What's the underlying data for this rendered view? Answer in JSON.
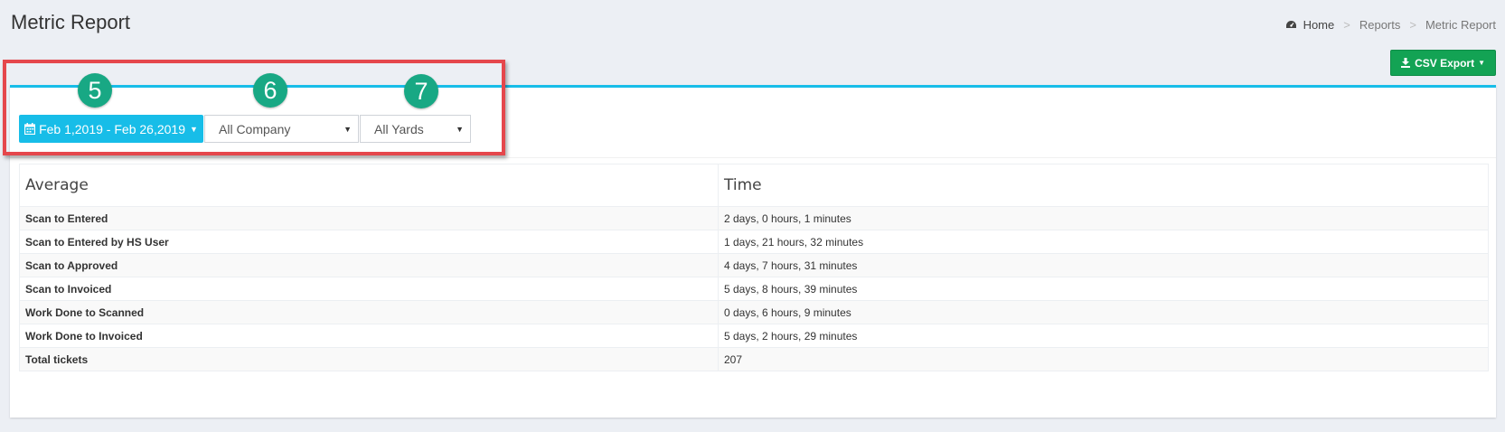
{
  "header": {
    "title": "Metric Report",
    "breadcrumb": {
      "home": "Home",
      "separator": ">",
      "items": [
        "Reports",
        "Metric Report"
      ]
    }
  },
  "toolbar": {
    "csv_export_label": "CSV Export",
    "csv_export_color": "#13a354"
  },
  "filters": {
    "date_range": "Feb 1,2019 - Feb 26,2019",
    "company": "All Company",
    "yards": "All Yards",
    "accent": "#17bde8"
  },
  "annotations": {
    "markers": [
      "5",
      "6",
      "7"
    ],
    "box_color": "#e5474c",
    "marker_color": "#18a884"
  },
  "table": {
    "columns": [
      "Average",
      "Time"
    ],
    "rows": [
      {
        "label": "Scan to Entered",
        "time": "2 days, 0 hours, 1 minutes"
      },
      {
        "label": "Scan to Entered by HS User",
        "time": "1 days, 21 hours, 32 minutes"
      },
      {
        "label": "Scan to Approved",
        "time": "4 days, 7 hours, 31 minutes"
      },
      {
        "label": "Scan to Invoiced",
        "time": "5 days, 8 hours, 39 minutes"
      },
      {
        "label": "Work Done to Scanned",
        "time": "0 days, 6 hours, 9 minutes"
      },
      {
        "label": "Work Done to Invoiced",
        "time": "5 days, 2 hours, 29 minutes"
      },
      {
        "label": "Total tickets",
        "time": "207"
      }
    ]
  }
}
